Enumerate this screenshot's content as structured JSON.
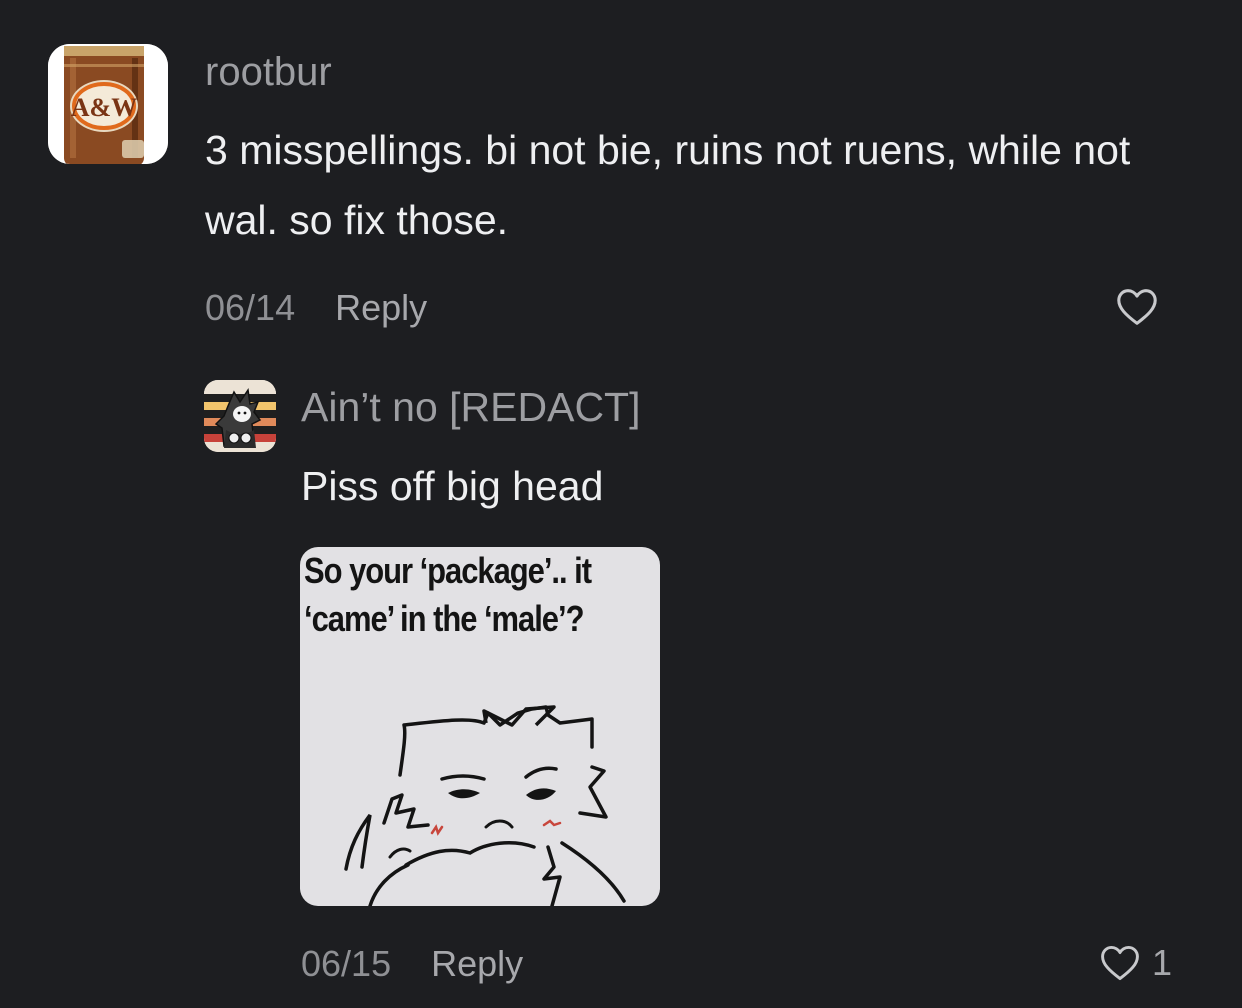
{
  "comments": [
    {
      "username": "rootbur",
      "avatar_icon": "aw-root-beer-can-avatar",
      "avatar_text": "A&W",
      "text": "3 misspellings. bi not bie, ruins not ruens, while not wal. so fix those.",
      "date": "06/14",
      "reply_label": "Reply",
      "like_icon": "heart-outline-icon",
      "replies": [
        {
          "username": "Ain’t no [REDACT]",
          "avatar_icon": "cartoon-creature-avatar",
          "text": "Piss off big head",
          "image": {
            "caption_lines": [
              "So your ‘package’.. it",
              "‘came’ in the ‘male’?"
            ],
            "icon": "meme-drawing"
          },
          "date": "06/15",
          "reply_label": "Reply",
          "like_icon": "heart-outline-icon",
          "like_count": "1"
        }
      ]
    }
  ],
  "colors": {
    "background": "#1d1e21",
    "primary_text": "#eeeff1",
    "secondary_text": "#9d9ea2",
    "meme_background": "#e2e1e4"
  }
}
